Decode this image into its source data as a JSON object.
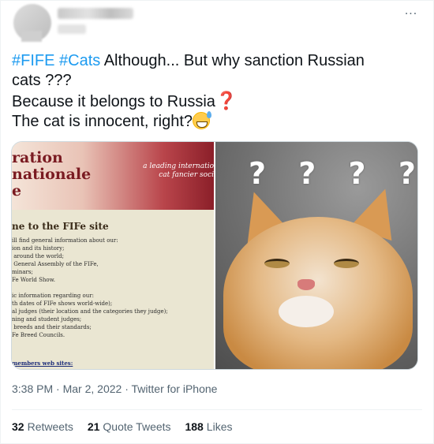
{
  "header": {
    "more_label": "..."
  },
  "tweet": {
    "hashtag_fife": "#FIFE",
    "hashtag_cats": "#Cats",
    "line1_rest": "Although... But why sanction Russian",
    "line2": "cats ???",
    "line3": "Because it belongs to Russia",
    "line3_emoji": "❓",
    "line4": "The cat is innocent, right?"
  },
  "media": {
    "fife_title": "ration\nnationale\ne",
    "fife_tagline": "a leading internatio\ncat fancier soci",
    "fife_welcome": "ne to the FIFe site",
    "fife_lines": [
      "ill find general information about our:",
      "ion and its history;",
      " around the world;",
      " General Assembly of the FIFe,",
      "minars;",
      "Fe World Show.",
      "",
      "ic information regarding our:",
      "th dates of FIFe shows world-wide);",
      "al judges (their location and the categories they judge);",
      "ning and student judges;",
      " breeds and their standards;",
      "Fe Breed Councils."
    ],
    "fife_bottom": " members web sites:",
    "cat_overlay": "? ? ? ?"
  },
  "meta": {
    "time": "3:38 PM",
    "sep1": " · ",
    "date": "Mar 2, 2022",
    "sep2": " · ",
    "source": "Twitter for iPhone"
  },
  "stats": [
    {
      "num": "32",
      "label": "Retweets"
    },
    {
      "num": "21",
      "label": "Quote Tweets"
    },
    {
      "num": "188",
      "label": "Likes"
    }
  ],
  "colors": {
    "link": "#1d9bf0",
    "text": "#0f1419",
    "secondary": "#536471"
  }
}
